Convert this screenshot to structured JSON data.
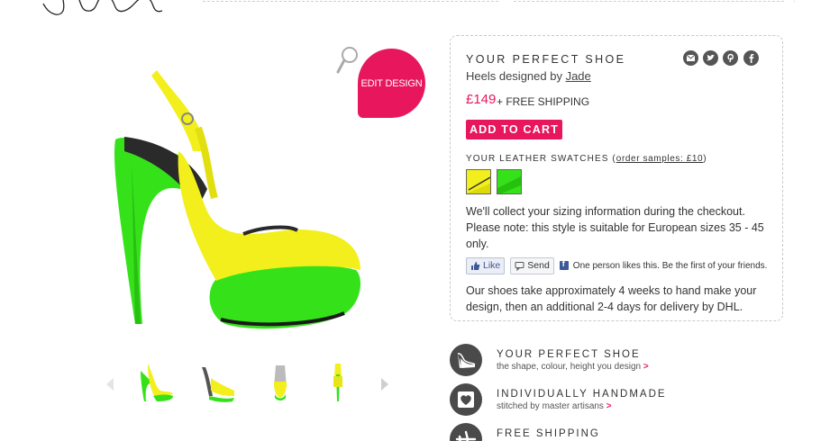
{
  "header": {
    "logo_icon": "signature-logo"
  },
  "product": {
    "edit_design_label": "EDIT DESIGN",
    "zoom_icon": "magnifier-icon",
    "colors": {
      "upper": "#f2ef1c",
      "platform": "#35e21a",
      "accent": "#e8175d"
    },
    "thumbnails": [
      "side-view",
      "angle-view",
      "back-view",
      "heel-view"
    ]
  },
  "panel": {
    "title": "YOUR PERFECT SHOE",
    "designer_prefix": "Heels designed by ",
    "designer_name": "Jade",
    "price": "£149",
    "shipping": "+ FREE SHIPPING",
    "add_to_cart": "ADD TO CART",
    "swatches_label": "YOUR LEATHER SWATCHES (",
    "order_samples": "order samples: £10",
    "swatches_label_end": ")",
    "swatches": [
      {
        "name": "yellow-leather",
        "color": "#f2ef1c"
      },
      {
        "name": "green-leather",
        "color": "#35e21a"
      }
    ],
    "sizing_line1": "We'll collect your sizing information during the checkout.",
    "sizing_line2": "Please note: this style is suitable for European sizes 35 - 45 only.",
    "fb_like": "Like",
    "fb_send": "Send",
    "fb_text": "One person likes this. Be the first of your friends.",
    "delivery": "Our shoes take approximately 4 weeks to hand make your design, then an additional 2-4 days for delivery by DHL.",
    "share_icons": [
      "email-icon",
      "twitter-icon",
      "pinterest-icon",
      "facebook-icon"
    ]
  },
  "features": [
    {
      "title": "YOUR PERFECT SHOE",
      "subtitle": "the shape, colour, height you design",
      "arrow": ">",
      "icon": "heel-shoe-icon"
    },
    {
      "title": "INDIVIDUALLY HANDMADE",
      "subtitle": "stitched by master artisans",
      "arrow": ">",
      "icon": "stitched-heart-icon"
    },
    {
      "title": "FREE SHIPPING",
      "subtitle": "",
      "arrow": "",
      "icon": "airplane-icon"
    }
  ]
}
